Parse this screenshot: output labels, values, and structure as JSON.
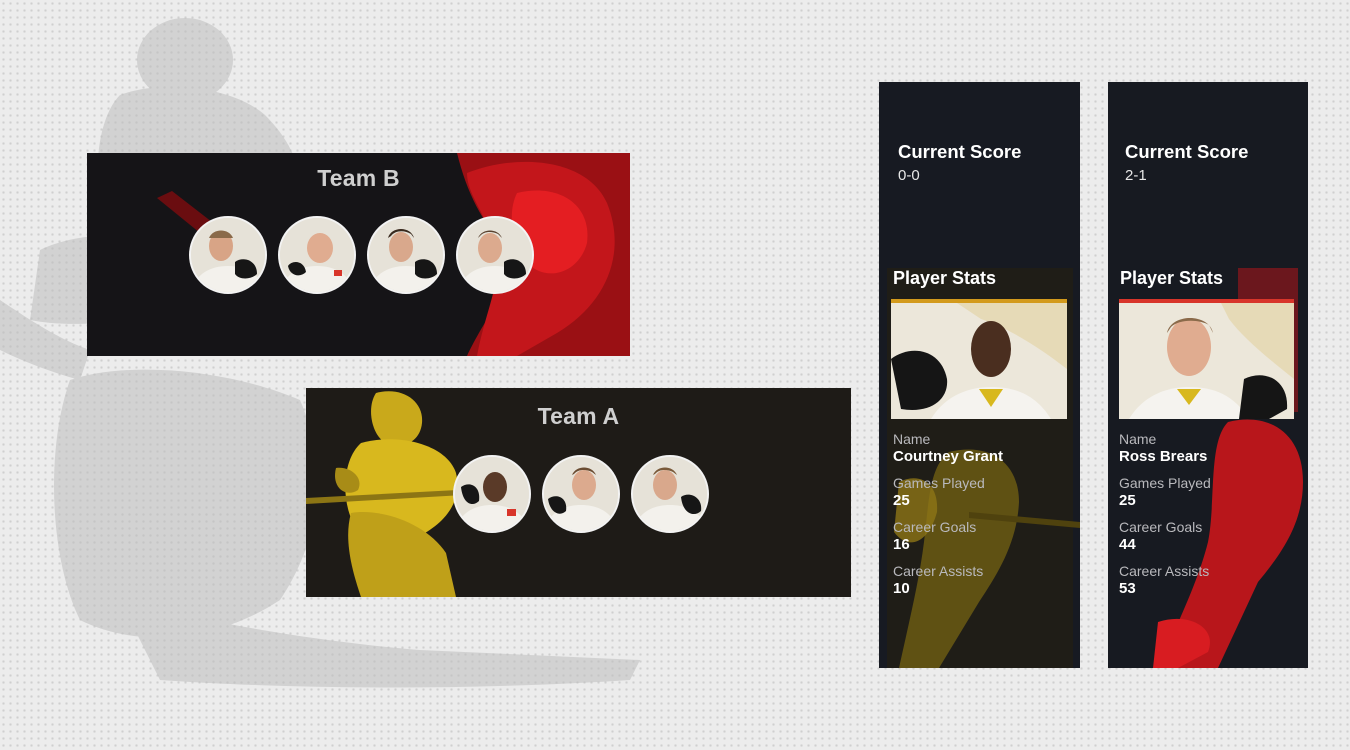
{
  "banners": {
    "team_b": {
      "title": "Team B",
      "accent": "#e0151b",
      "players": [
        {
          "icon": "player-avatar-icon"
        },
        {
          "icon": "player-avatar-icon"
        },
        {
          "icon": "player-avatar-icon"
        },
        {
          "icon": "player-avatar-icon"
        }
      ]
    },
    "team_a": {
      "title": "Team A",
      "accent": "#d8b81e",
      "players": [
        {
          "icon": "player-avatar-icon"
        },
        {
          "icon": "player-avatar-icon"
        },
        {
          "icon": "player-avatar-icon"
        }
      ]
    }
  },
  "cards": [
    {
      "score_label": "Current Score",
      "score_value": "0-0",
      "stats_title": "Player Stats",
      "accent": "#d8b81e",
      "stats": [
        {
          "label": "Name",
          "value": "Courtney Grant"
        },
        {
          "label": "Games Played",
          "value": "25"
        },
        {
          "label": "Career Goals",
          "value": "16"
        },
        {
          "label": "Career Assists",
          "value": "10"
        }
      ]
    },
    {
      "score_label": "Current Score",
      "score_value": "2-1",
      "stats_title": "Player Stats",
      "accent": "#e0151b",
      "stats": [
        {
          "label": "Name",
          "value": "Ross Brears"
        },
        {
          "label": "Games Played",
          "value": "25"
        },
        {
          "label": "Career Goals",
          "value": "44"
        },
        {
          "label": "Career Assists",
          "value": "53"
        }
      ]
    }
  ]
}
